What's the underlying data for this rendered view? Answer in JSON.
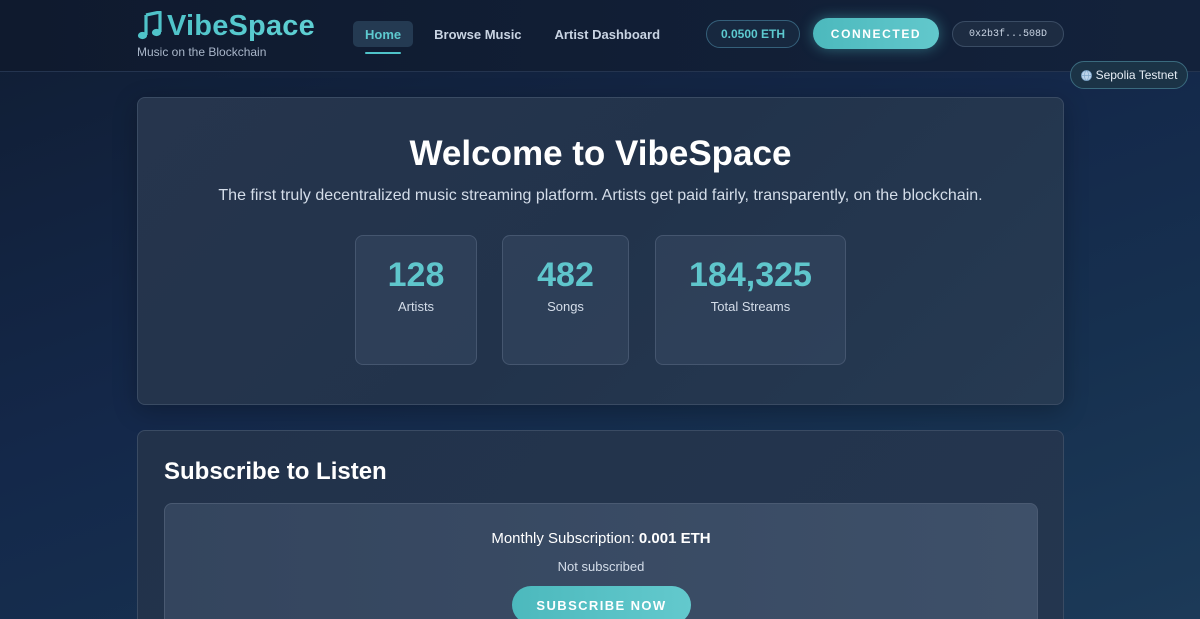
{
  "brand": {
    "name": "VibeSpace",
    "tagline": "Music on the Blockchain",
    "icon": "music-note-icon"
  },
  "nav": {
    "items": [
      {
        "label": "Home",
        "active": true
      },
      {
        "label": "Browse Music",
        "active": false
      },
      {
        "label": "Artist Dashboard",
        "active": false
      }
    ]
  },
  "wallet": {
    "balance": "0.0500 ETH",
    "connect_label": "CONNECTED",
    "address": "0x2b3f...508D",
    "network": "Sepolia Testnet"
  },
  "hero": {
    "title": "Welcome to VibeSpace",
    "subtitle": "The first truly decentralized music streaming platform. Artists get paid fairly, transparently, on the blockchain.",
    "stats": [
      {
        "value": "128",
        "label": "Artists"
      },
      {
        "value": "482",
        "label": "Songs"
      },
      {
        "value": "184,325",
        "label": "Total Streams"
      }
    ]
  },
  "subscribe": {
    "title": "Subscribe to Listen",
    "price_label": "Monthly Subscription: ",
    "price_value": "0.001 ETH",
    "status": "Not subscribed",
    "button_label": "SUBSCRIBE NOW"
  },
  "colors": {
    "accent": "#4fc3c9",
    "background": "#14284a",
    "card": "#26354d"
  }
}
